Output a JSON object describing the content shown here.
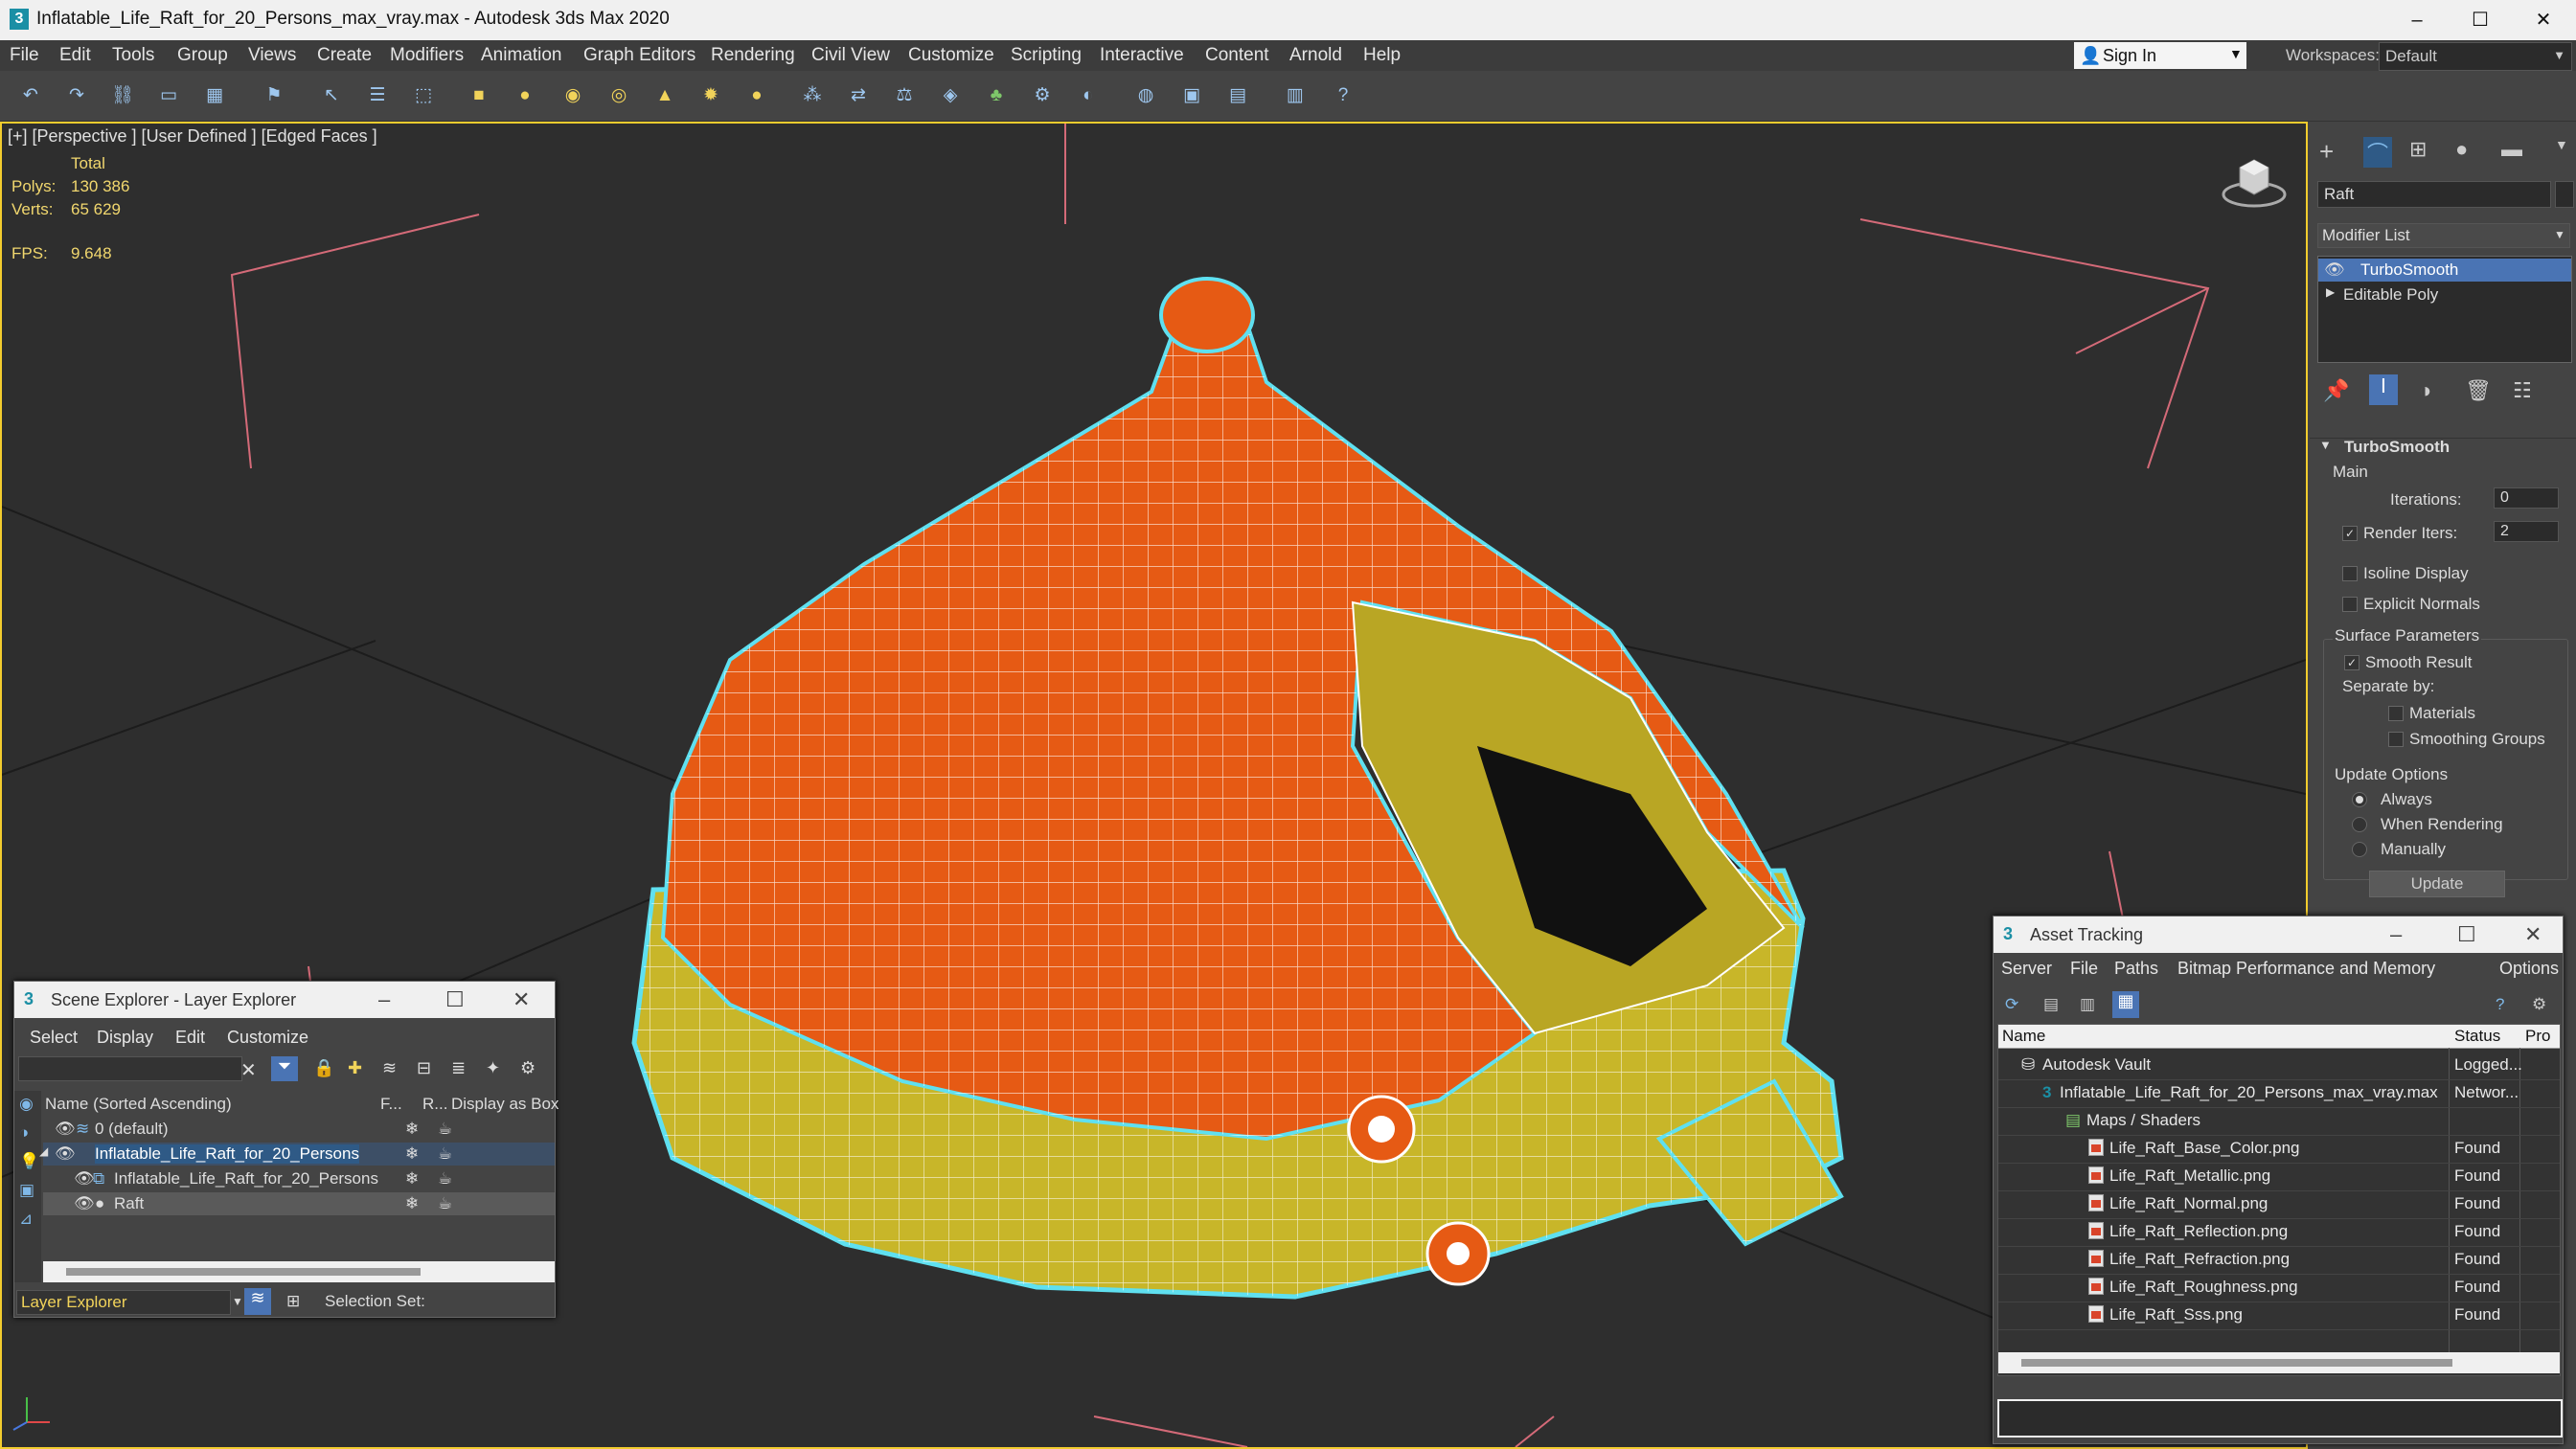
{
  "window": {
    "title": "Inflatable_Life_Raft_for_20_Persons_max_vray.max - Autodesk 3ds Max 2020",
    "app_icon": "3",
    "controls": [
      "–",
      "☐",
      "✕"
    ]
  },
  "menubar": {
    "items": [
      "File",
      "Edit",
      "Tools",
      "Group",
      "Views",
      "Create",
      "Modifiers",
      "Animation",
      "Graph Editors",
      "Rendering",
      "Civil View",
      "Customize",
      "Scripting",
      "Interactive",
      "Content",
      "Arnold",
      "Help"
    ],
    "sign_in": "Sign In",
    "workspaces_label": "Workspaces:",
    "workspace_value": "Default"
  },
  "viewport": {
    "label": "[+] [Perspective ]  [User Defined ]  [Edged Faces ]",
    "stats": {
      "header": "Total",
      "polys_label": "Polys:",
      "polys_value": "130 386",
      "verts_label": "Verts:",
      "verts_value": "65 629",
      "fps_label": "FPS:",
      "fps_value": "9.648"
    },
    "colors": {
      "orange": "#e85a16",
      "yellow": "#c9b52a",
      "selection": "#5fe0f0",
      "wire": "#ffffff"
    }
  },
  "command_panel": {
    "object_name": "Raft",
    "modifier_list": "Modifier List",
    "stack": [
      "TurboSmooth",
      "Editable Poly"
    ],
    "rollout_title": "TurboSmooth",
    "main_label": "Main",
    "iterations_label": "Iterations:",
    "iterations_value": "0",
    "render_iters_label": "Render Iters:",
    "render_iters_value": "2",
    "render_iters_checked": true,
    "isoline_display": "Isoline Display",
    "explicit_normals": "Explicit Normals",
    "surface_params": "Surface Parameters",
    "smooth_result": "Smooth Result",
    "separate_by": "Separate by:",
    "materials": "Materials",
    "smoothing_groups": "Smoothing Groups",
    "update_options": "Update Options",
    "always": "Always",
    "when_rendering": "When Rendering",
    "manually": "Manually",
    "update_button": "Update"
  },
  "scene_explorer": {
    "title": "Scene Explorer - Layer Explorer",
    "menu": [
      "Select",
      "Display",
      "Edit",
      "Customize"
    ],
    "columns": [
      "Name (Sorted Ascending)",
      "F...",
      "R...",
      "Display as Box"
    ],
    "rows": [
      {
        "label": "0 (default)",
        "indent": 0
      },
      {
        "label": "Inflatable_Life_Raft_for_20_Persons",
        "indent": 0
      },
      {
        "label": "Inflatable_Life_Raft_for_20_Persons",
        "indent": 1
      },
      {
        "label": "Raft",
        "indent": 1
      }
    ],
    "footer_label": "Layer Explorer",
    "selection_set": "Selection Set:"
  },
  "asset_tracking": {
    "title": "Asset Tracking",
    "menu": [
      "Server",
      "File",
      "Paths",
      "Bitmap Performance and Memory",
      "Options"
    ],
    "columns": [
      "Name",
      "Status",
      "Pro"
    ],
    "rows": [
      {
        "name": "Autodesk Vault",
        "status": "Logged..."
      },
      {
        "name": "Inflatable_Life_Raft_for_20_Persons_max_vray.max",
        "status": "Networ..."
      },
      {
        "name": "Maps / Shaders",
        "status": ""
      },
      {
        "name": "Life_Raft_Base_Color.png",
        "status": "Found"
      },
      {
        "name": "Life_Raft_Metallic.png",
        "status": "Found"
      },
      {
        "name": "Life_Raft_Normal.png",
        "status": "Found"
      },
      {
        "name": "Life_Raft_Reflection.png",
        "status": "Found"
      },
      {
        "name": "Life_Raft_Refraction.png",
        "status": "Found"
      },
      {
        "name": "Life_Raft_Roughness.png",
        "status": "Found"
      },
      {
        "name": "Life_Raft_Sss.png",
        "status": "Found"
      }
    ]
  }
}
